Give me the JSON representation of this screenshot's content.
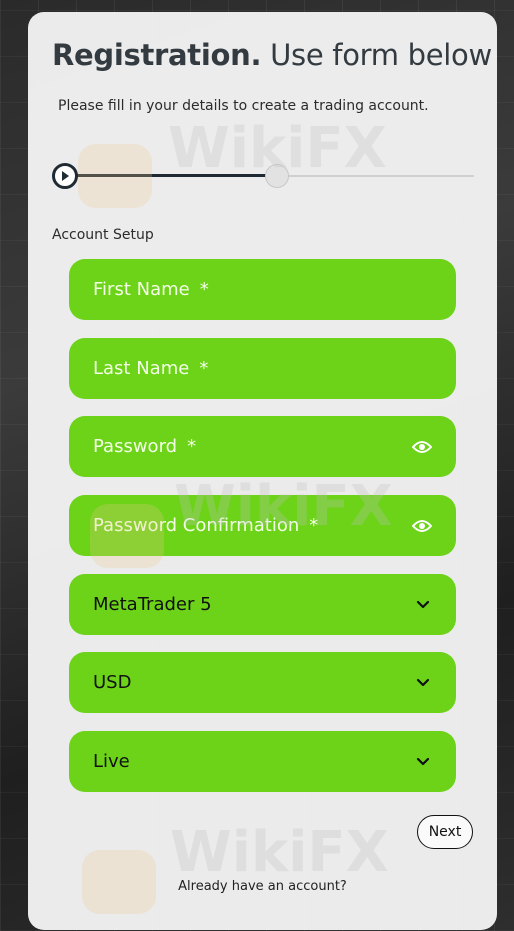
{
  "header": {
    "title_lead": "Registration.",
    "title_rest": " Use form below",
    "subtitle": "Please fill in your details to create a trading account."
  },
  "stepper": {
    "current_step": 1,
    "total_steps": 2
  },
  "section": {
    "label": "Account Setup"
  },
  "fields": [
    {
      "label": "First Name",
      "required": "*"
    },
    {
      "label": "Last Name",
      "required": "*"
    },
    {
      "label": "Password",
      "required": "*",
      "icon": "eye-icon"
    },
    {
      "label": "Password Confirmation",
      "required": "*",
      "icon": "eye-icon"
    }
  ],
  "selects": [
    {
      "value": "MetaTrader 5",
      "icon": "chevron-down-icon"
    },
    {
      "value": "USD",
      "icon": "chevron-down-icon"
    },
    {
      "value": "Live",
      "icon": "chevron-down-icon"
    }
  ],
  "actions": {
    "next_label": "Next"
  },
  "footer": {
    "login_prompt": "Already have an account?"
  },
  "watermark": {
    "text": "WikiFX"
  },
  "colors": {
    "field_bg": "#6cd319",
    "card_bg": "#f4f4f4",
    "title": "#333b41"
  }
}
